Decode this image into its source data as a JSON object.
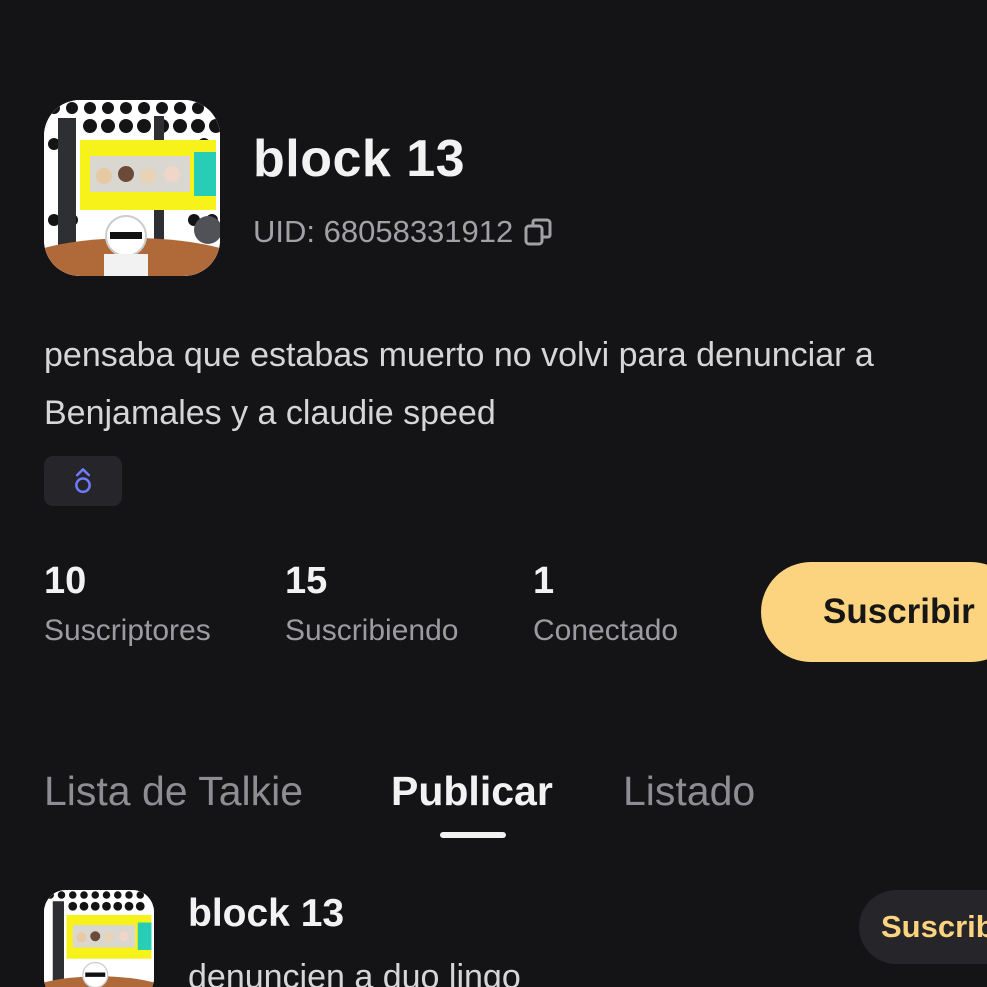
{
  "profile": {
    "name": "block 13",
    "uid_text": "UID: 68058331912",
    "bio": "pensaba que estabas muerto no volvi para denunciar a Benjamales y a claudie speed",
    "gender_icon": "male-symbol-icon",
    "accent_color": "#fcd37f"
  },
  "stats": [
    {
      "value": "10",
      "label": "Suscriptores"
    },
    {
      "value": "15",
      "label": "Suscribiendo"
    },
    {
      "value": "1",
      "label": "Conectado"
    }
  ],
  "subscribe_button": {
    "label": "Suscribir"
  },
  "tabs": [
    {
      "label": "Lista de Talkie",
      "active": false
    },
    {
      "label": "Publicar",
      "active": true
    },
    {
      "label": "Listado",
      "active": false
    }
  ],
  "post": {
    "author": "block 13",
    "text": "denuncien a duo lingo",
    "subscribe_label": "Suscribir"
  }
}
